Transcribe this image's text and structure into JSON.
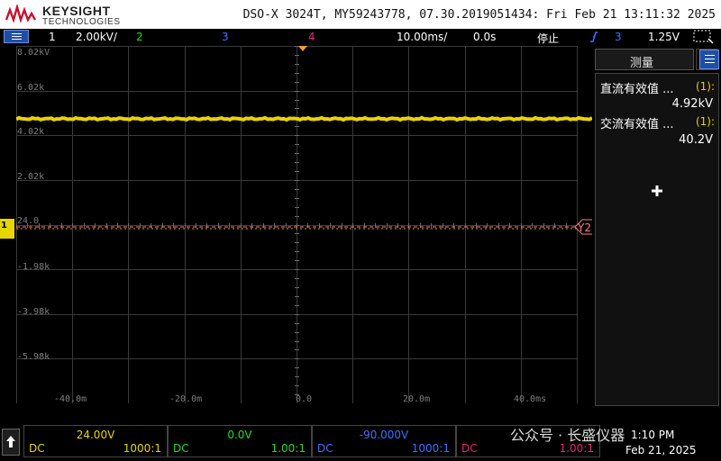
{
  "header": {
    "brand": "KEYSIGHT",
    "brand_sub": "TECHNOLOGIES",
    "scope_info": "DSO-X 3024T, MY59243778, 07.30.2019051434: Fri Feb 21 13:11:32 2025"
  },
  "status": {
    "ch1_num": "1",
    "ch1_scale": "2.00kV/",
    "ch2_num": "2",
    "ch3_num": "3",
    "ch4_num": "4",
    "timebase": "10.00ms/",
    "delay": "0.0s",
    "run_state": "停止",
    "trig_source": "3",
    "trig_level": "1.25V"
  },
  "graticule": {
    "y_labels": [
      "8.02kV",
      "6.02k",
      "4.02k",
      "2.02k",
      "24.0",
      "-1.98k",
      "-3.98k",
      "-5.98k"
    ],
    "x_labels": [
      "-40.0m",
      "-20.0m",
      "0.0",
      "20.0m",
      "40.0ms"
    ],
    "ch1_marker": "1",
    "y2_cursor_label": "Y2"
  },
  "measurements": {
    "title": "测量",
    "items": [
      {
        "name": "直流有效值 ...",
        "source": "(1):",
        "value": "4.92kV"
      },
      {
        "name": "交流有效值 ...",
        "source": "(1):",
        "value": "40.2V"
      }
    ]
  },
  "channels": [
    {
      "value": "24.00V",
      "coupling": "DC",
      "probe": "1000:1",
      "color": "#e8d400"
    },
    {
      "value": "0.0V",
      "coupling": "DC",
      "probe": "1.00:1",
      "color": "#26d926"
    },
    {
      "value": "-90.000V",
      "coupling": "DC",
      "probe": "1000:1",
      "color": "#3f6fff"
    },
    {
      "value": "",
      "coupling": "DC",
      "probe": "1.00:1",
      "color": "#e0287a"
    }
  ],
  "clock": {
    "time": "1:10 PM",
    "date": "Feb 21, 2025"
  },
  "watermark": "公众号 · 长盛仪器",
  "colors": {
    "ch1": "#e8d400",
    "ch2": "#26d926",
    "ch3": "#3f6fff",
    "ch4": "#e0287a",
    "trigger": "#ff9a2e",
    "cursor": "#ff7f7f"
  },
  "trace": {
    "ch1_level_kv": 4.92
  }
}
